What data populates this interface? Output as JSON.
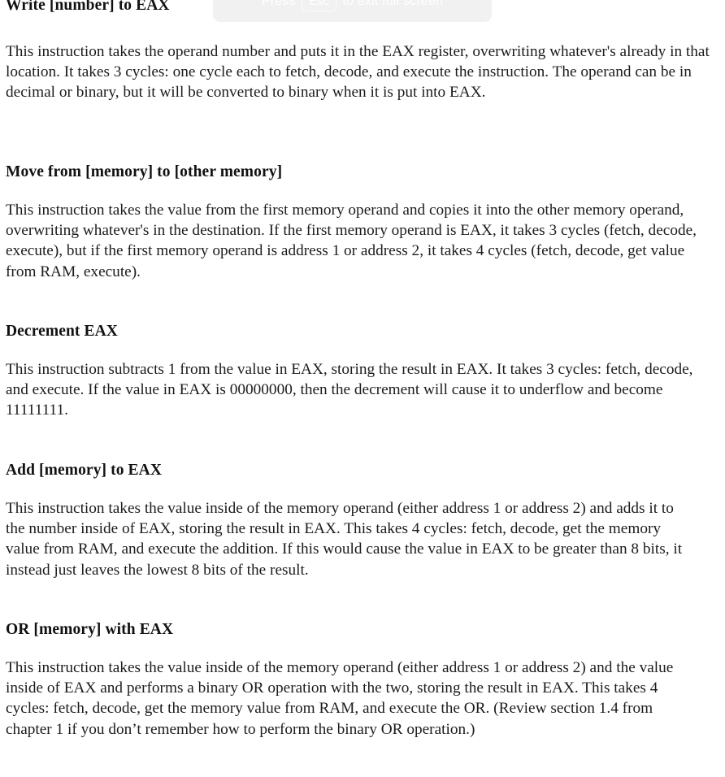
{
  "overlay": {
    "prefix": "Press",
    "key_label": "Esc",
    "suffix": "to exit full screen",
    "background_color": "#f1f1f1",
    "text_color": "#ffffff"
  },
  "document": {
    "background_color": "#ffffff",
    "text_color": "#1c1c1c",
    "sections": [
      {
        "id": "write",
        "heading": "Write [number] to EAX",
        "body": "This instruction takes the operand number and puts it in the EAX register, overwriting whatever's already in that location. It takes 3 cycles: one cycle each to fetch, decode, and execute the instruction. The operand can be in decimal or binary, but it will be converted to binary when it is put into EAX."
      },
      {
        "id": "move",
        "heading": "Move from [memory] to [other memory]",
        "body": "This instruction takes the value from the first memory operand and copies it into the other memory operand, overwriting whatever's in the destination. If the first memory operand is EAX, it takes 3 cycles (fetch, decode, execute), but if the first memory operand is address 1 or address 2, it takes 4 cycles (fetch, decode, get value from RAM, execute)."
      },
      {
        "id": "decrement",
        "heading": "Decrement EAX",
        "body": "This instruction subtracts 1 from the value in EAX, storing the result in EAX. It takes 3 cycles: fetch, decode, and execute. If the value in EAX is 00000000, then the decrement will cause it to underflow and become 11111111."
      },
      {
        "id": "add",
        "heading": "Add [memory] to EAX",
        "body": "This instruction takes the value inside of the memory operand (either address 1 or address 2) and adds it to the number inside of EAX, storing the result in EAX. This takes 4 cycles: fetch, decode, get the memory value from RAM, and execute the addition. If this would cause the value in EAX to be greater than 8 bits, it instead just leaves the lowest 8 bits of the result."
      },
      {
        "id": "or",
        "heading": "OR [memory] with EAX",
        "body": "This instruction takes the value inside of the memory operand (either address 1 or address 2) and the value inside of EAX and performs a binary OR operation with the two, storing the result in EAX. This takes 4 cycles: fetch, decode, get the memory value from RAM, and execute the OR. (Review section 1.4 from chapter 1 if you don’t remember how to perform the binary OR operation.)"
      }
    ]
  }
}
